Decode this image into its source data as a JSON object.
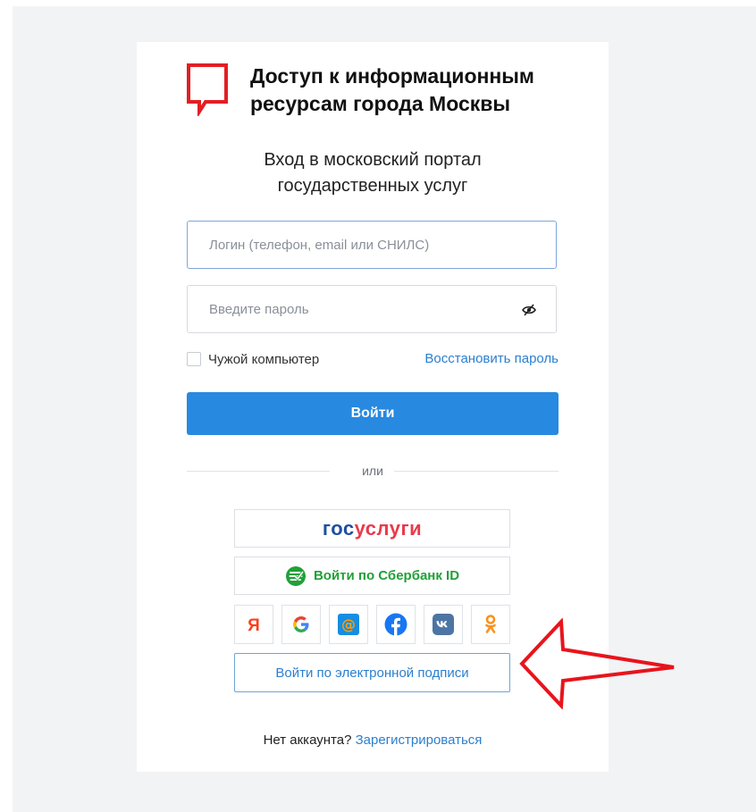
{
  "brand": {
    "title_line1": "Доступ к информационным",
    "title_line2": "ресурсам города Москвы",
    "accent_color": "#e31e24"
  },
  "subtitle": {
    "line1": "Вход в московский портал",
    "line2": "государственных услуг"
  },
  "form": {
    "login_placeholder": "Логин (телефон, email или СНИЛС)",
    "password_placeholder": "Введите пароль",
    "remember_label": "Чужой компьютер",
    "restore_link": "Восстановить пароль",
    "submit_label": "Войти"
  },
  "divider_text": "или",
  "alt_login": {
    "gosuslugi_part1": "гос",
    "gosuslugi_part2": "услуги",
    "sber_label": "Войти по Сбербанк ID",
    "esign_label": "Войти по электронной подписи"
  },
  "socials": [
    {
      "name": "yandex",
      "icon": "yandex-icon"
    },
    {
      "name": "google",
      "icon": "google-icon"
    },
    {
      "name": "mailru",
      "icon": "mailru-icon"
    },
    {
      "name": "facebook",
      "icon": "facebook-icon"
    },
    {
      "name": "vk",
      "icon": "vk-icon"
    },
    {
      "name": "odnoklassniki",
      "icon": "odnoklassniki-icon"
    }
  ],
  "register": {
    "text": "Нет аккаунта?",
    "link": "Зарегистрироваться"
  },
  "colors": {
    "primary": "#2889e0",
    "link": "#2b7fd0",
    "sber_green": "#21a038",
    "annotation_arrow": "#e8141c"
  }
}
